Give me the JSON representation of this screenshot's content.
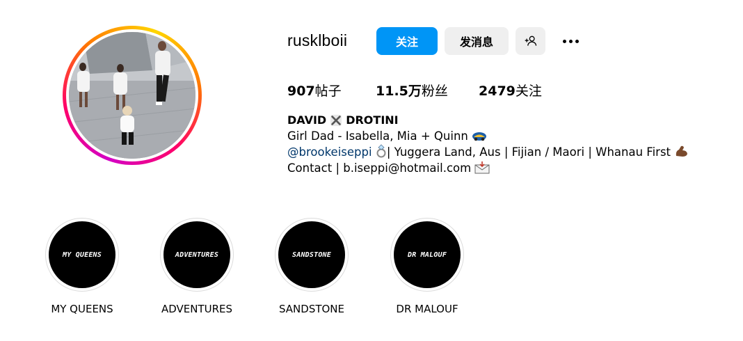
{
  "profile": {
    "username": "rusklboii",
    "buttons": {
      "follow": "关注",
      "message": "发消息"
    },
    "stats": {
      "posts_count": "907",
      "posts_label": "帖子",
      "followers_count": "11.5万",
      "followers_label": "粉丝",
      "following_count": "2479",
      "following_label": "关注"
    },
    "bio": {
      "name_left": "DAVID",
      "name_right": "DROTINI",
      "line1": "Girl Dad - Isabella, Mia + Quinn",
      "mention": "@brookeiseppi",
      "line2_rest": "| Yuggera Land, Aus | Fijian / Maori | Whanau First",
      "line3": "Contact | b.iseppi@hotmail.com"
    }
  },
  "highlights": [
    {
      "cover_text": "MY QUEENS",
      "label": "MY QUEENS"
    },
    {
      "cover_text": "ADVENTURES",
      "label": "ADVENTURES"
    },
    {
      "cover_text": "SANDSTONE",
      "label": "SANDSTONE"
    },
    {
      "cover_text": "DR MALOUF",
      "label": "DR MALOUF"
    }
  ],
  "colors": {
    "accent": "#0095f6",
    "secondary_button": "#efefef",
    "mention": "#00376b"
  },
  "icons": [
    "add-person-icon",
    "more-options-icon",
    "crossed-swords-icon",
    "ring-icon",
    "flexed-arm-icon",
    "envelope-icon",
    "car-emoji-icon"
  ]
}
